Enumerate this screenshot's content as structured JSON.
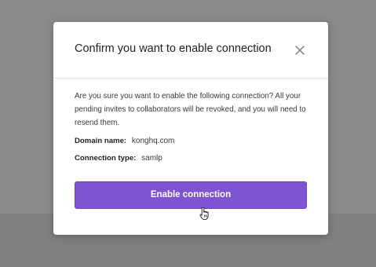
{
  "modal": {
    "title": "Confirm you want to enable connection",
    "close_icon": "close-icon",
    "message": "Are you sure you want to enable the following connection? All your pending invites to collaborators will be revoked, and you will need to resend them.",
    "fields": {
      "domain_label": "Domain name:",
      "domain_value": "konghq.com",
      "type_label": "Connection type:",
      "type_value": "samlp"
    },
    "confirm_label": "Enable connection",
    "colors": {
      "accent": "#7e54d2",
      "backdrop": "#8a8a8a"
    }
  },
  "cursor_icon": "hand-pointer-icon"
}
